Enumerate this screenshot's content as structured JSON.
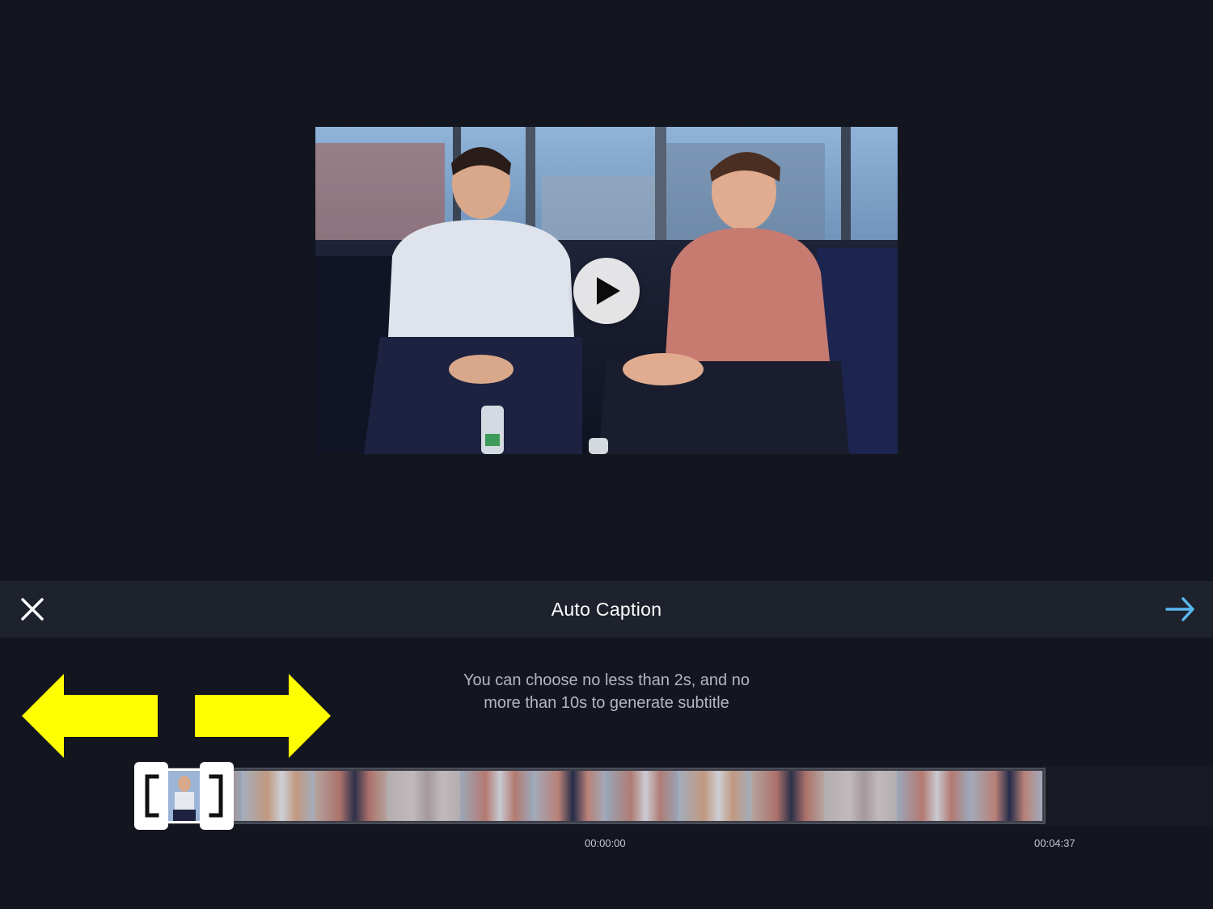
{
  "toolbar": {
    "title": "Auto Caption",
    "close_icon": "close-icon",
    "next_icon": "arrow-right-icon",
    "accent_color": "#5ab7ef"
  },
  "video": {
    "state": "paused",
    "play_icon": "play-icon"
  },
  "hint": {
    "line1": "You can choose no less than 2s, and no",
    "line2": "more than 10s to generate subtitle"
  },
  "overlay": {
    "left_arrow_icon": "arrow-left-icon",
    "right_arrow_icon": "arrow-right-icon",
    "color": "#ffff00"
  },
  "timeline": {
    "start_time": "00:00:00",
    "end_time": "00:04:37",
    "frame_count": 12
  }
}
